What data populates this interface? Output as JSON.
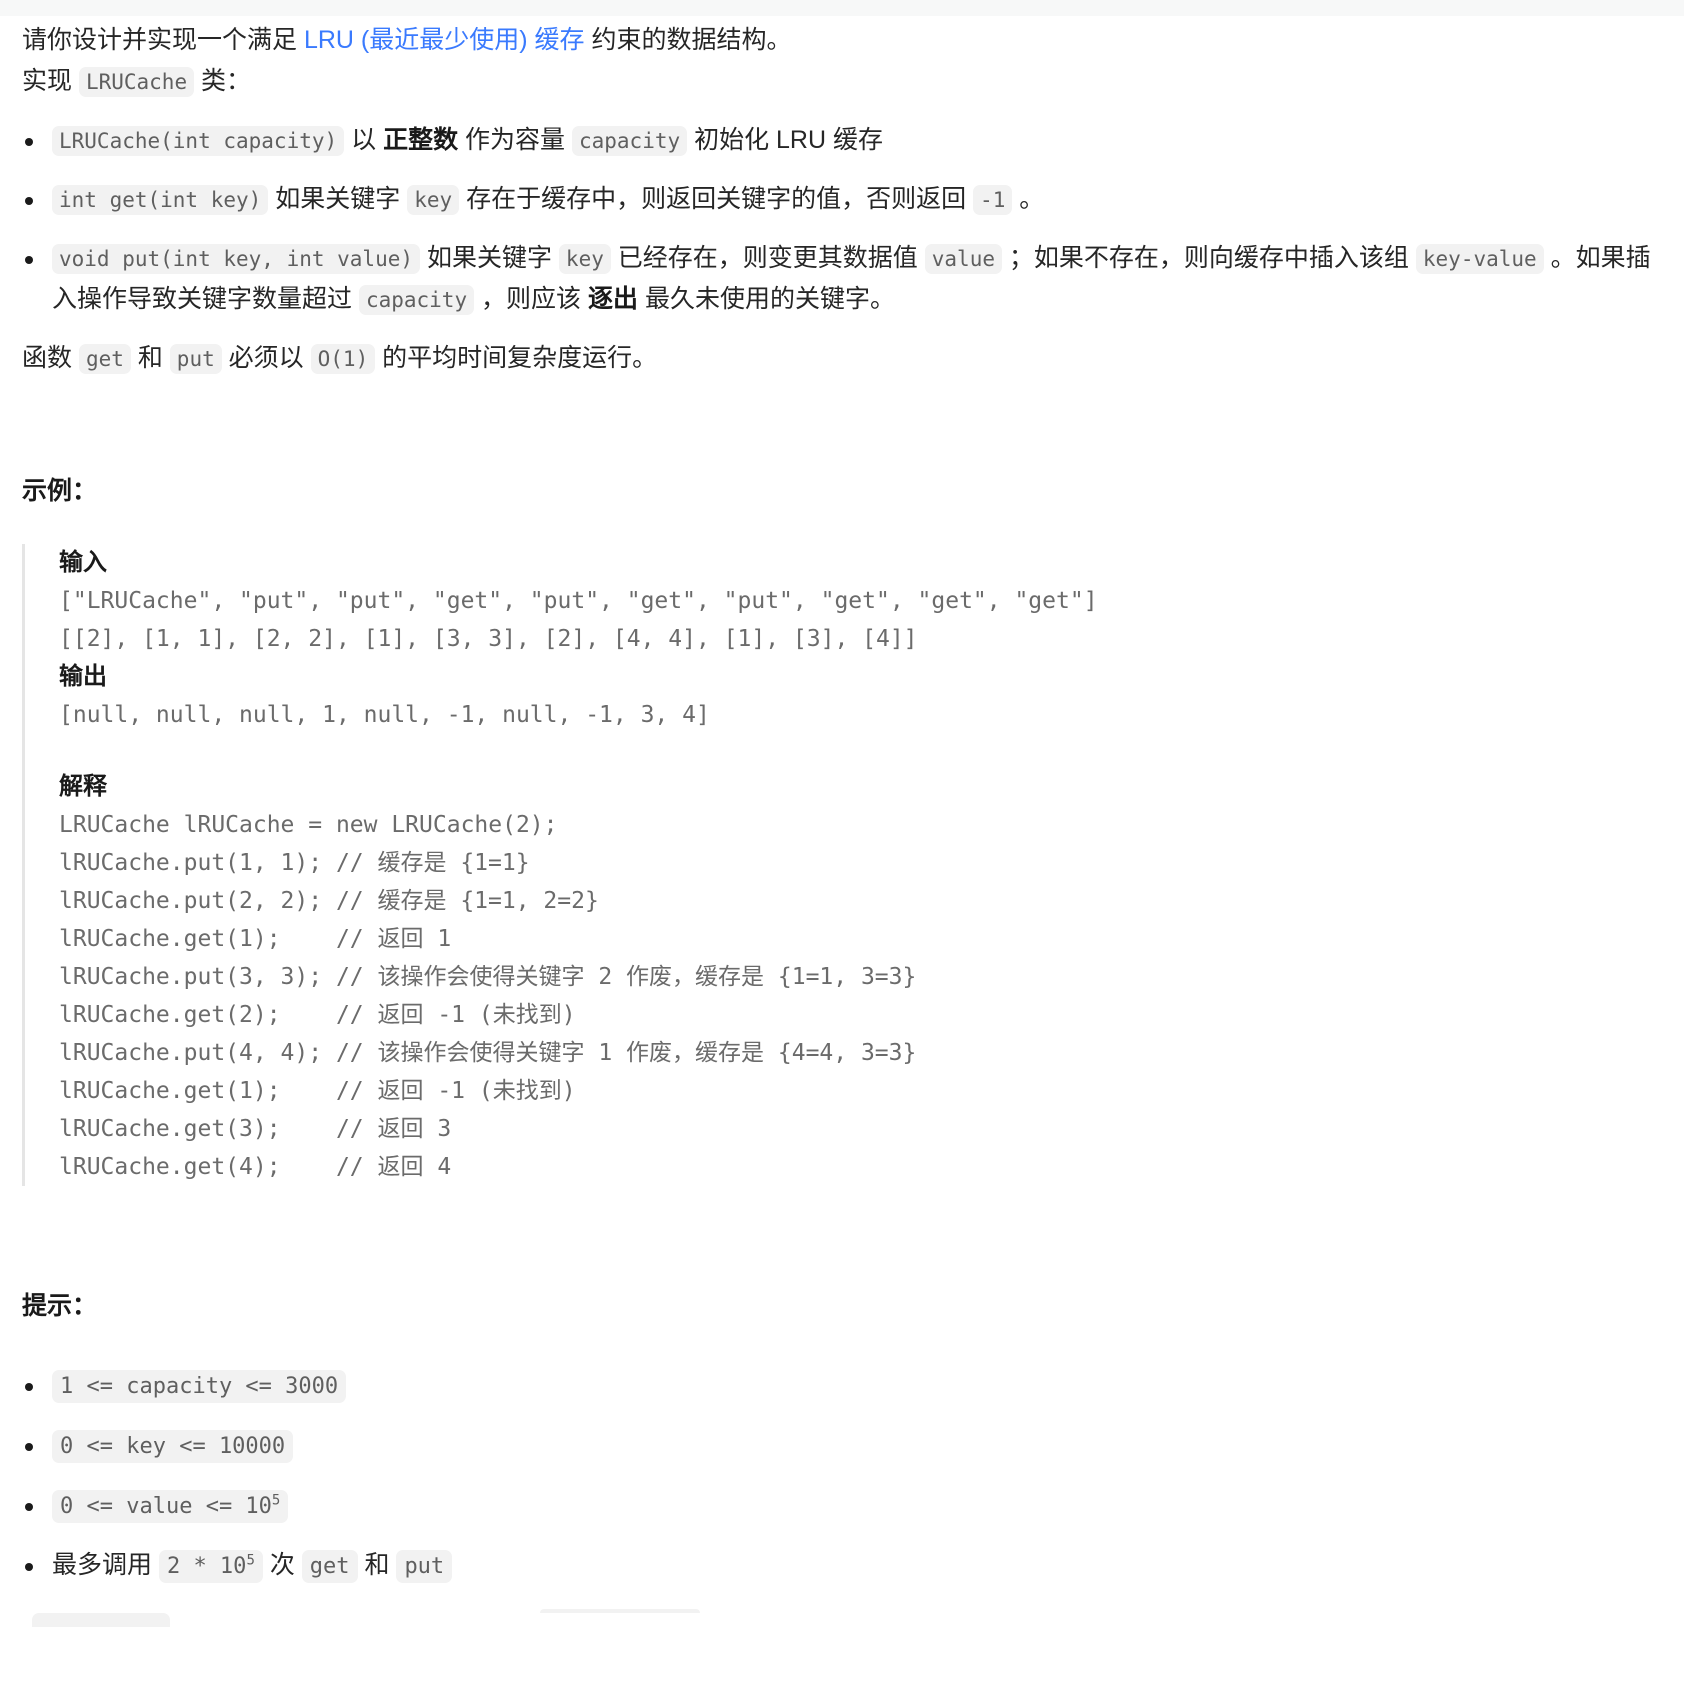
{
  "problem": {
    "intro_prefix": "请你设计并实现一个满足 ",
    "intro_link": "LRU (最近最少使用) 缓存",
    "intro_suffix": " 约束的数据结构。",
    "implement_prefix": "实现 ",
    "implement_class": "LRUCache",
    "implement_suffix": " 类：",
    "methods": [
      {
        "signature": "LRUCache(int capacity)",
        "text_1": " 以 ",
        "bold_1": "正整数",
        "text_2": " 作为容量 ",
        "code_2": "capacity",
        "text_3": " 初始化 LRU 缓存"
      },
      {
        "signature": "int get(int key)",
        "text_1": " 如果关键字 ",
        "code_1": "key",
        "text_2": " 存在于缓存中，则返回关键字的值，否则返回 ",
        "code_2": "-1",
        "text_3": " 。"
      },
      {
        "signature": "void put(int key, int value)",
        "text_1": " 如果关键字 ",
        "code_1": "key",
        "text_2": " 已经存在，则变更其数据值 ",
        "code_2": "value",
        "text_3": " ；如果不存在，则向缓存中插入该组 ",
        "code_3": "key-value",
        "text_4": " 。如果插入操作导致关键字数量超过 ",
        "code_4": "capacity",
        "text_5": " ，则应该 ",
        "bold_5": "逐出",
        "text_6": " 最久未使用的关键字。"
      }
    ],
    "complexity_prefix": "函数 ",
    "complexity_get": "get",
    "complexity_mid": " 和 ",
    "complexity_put": "put",
    "complexity_mid2": " 必须以 ",
    "complexity_o1": "O(1)",
    "complexity_suffix": " 的平均时间复杂度运行。"
  },
  "example": {
    "heading": "示例：",
    "input_label": "输入",
    "input_line_1": "[\"LRUCache\", \"put\", \"put\", \"get\", \"put\", \"get\", \"put\", \"get\", \"get\", \"get\"]",
    "input_line_2": "[[2], [1, 1], [2, 2], [1], [3, 3], [2], [4, 4], [1], [3], [4]]",
    "output_label": "输出",
    "output_line": "[null, null, null, 1, null, -1, null, -1, 3, 4]",
    "explain_label": "解释",
    "explain_code": "LRUCache lRUCache = new LRUCache(2);\nlRUCache.put(1, 1); // 缓存是 {1=1}\nlRUCache.put(2, 2); // 缓存是 {1=1, 2=2}\nlRUCache.get(1);    // 返回 1\nlRUCache.put(3, 3); // 该操作会使得关键字 2 作废，缓存是 {1=1, 3=3}\nlRUCache.get(2);    // 返回 -1 (未找到)\nlRUCache.put(4, 4); // 该操作会使得关键字 1 作废，缓存是 {4=4, 3=3}\nlRUCache.get(1);    // 返回 -1 (未找到)\nlRUCache.get(3);    // 返回 3\nlRUCache.get(4);    // 返回 4"
  },
  "hints": {
    "heading": "提示：",
    "items": [
      {
        "code": "1 <= capacity <= 3000"
      },
      {
        "code": "0 <= key <= 10000"
      },
      {
        "code": "0 <= value <= 10",
        "sup": "5"
      },
      {
        "prefix": "最多调用 ",
        "code": "2 * 10",
        "sup": "5",
        "mid": " 次 ",
        "code2": "get",
        "mid2": " 和 ",
        "code3": "put"
      }
    ]
  },
  "colors": {
    "link": "#3a7afe",
    "code_bg": "#f2f2f2",
    "code_fg": "#5f5f5f",
    "text": "#262626",
    "quote_border": "#e5e5e5",
    "topbar_bg": "#f7f8f8"
  }
}
